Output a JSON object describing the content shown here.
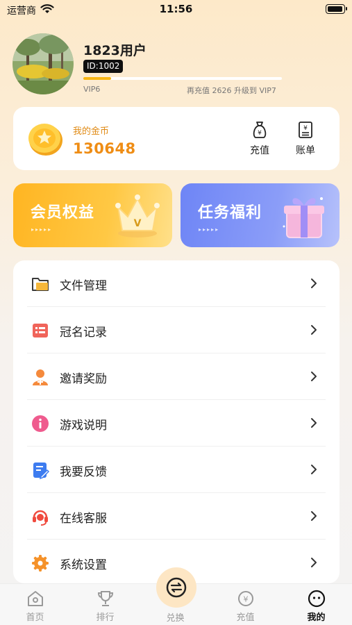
{
  "status_bar": {
    "carrier": "运营商",
    "time": "11:56"
  },
  "profile": {
    "username": "1823用户",
    "id_badge": "ID:1002",
    "vip_current": "VIP6",
    "vip_next": "再充值 2626 升级到 VIP7",
    "progress_fraction": 0.14
  },
  "coins": {
    "label": "我的金币",
    "value": "130648",
    "recharge_label": "充值",
    "bill_label": "账单"
  },
  "banners": {
    "member_title": "会员权益",
    "task_title": "任务福利"
  },
  "menu": [
    {
      "label": "文件管理",
      "icon": "folder-icon"
    },
    {
      "label": "冠名记录",
      "icon": "record-list-icon"
    },
    {
      "label": "邀请奖励",
      "icon": "invite-user-icon"
    },
    {
      "label": "游戏说明",
      "icon": "info-icon"
    },
    {
      "label": "我要反馈",
      "icon": "feedback-edit-icon"
    },
    {
      "label": "在线客服",
      "icon": "headset-icon"
    },
    {
      "label": "系统设置",
      "icon": "gear-icon"
    }
  ],
  "tabs": [
    {
      "label": "首页",
      "icon": "home-icon"
    },
    {
      "label": "排行",
      "icon": "trophy-icon"
    },
    {
      "label": "兑换",
      "icon": "exchange-icon"
    },
    {
      "label": "充值",
      "icon": "yen-recharge-icon"
    },
    {
      "label": "我的",
      "icon": "smile-face-icon",
      "active": true
    }
  ],
  "colors": {
    "accent_orange": "#ef8d15",
    "progress": "#f9b714",
    "member_banner": "#ffb522",
    "task_banner": "#6e85f6"
  }
}
